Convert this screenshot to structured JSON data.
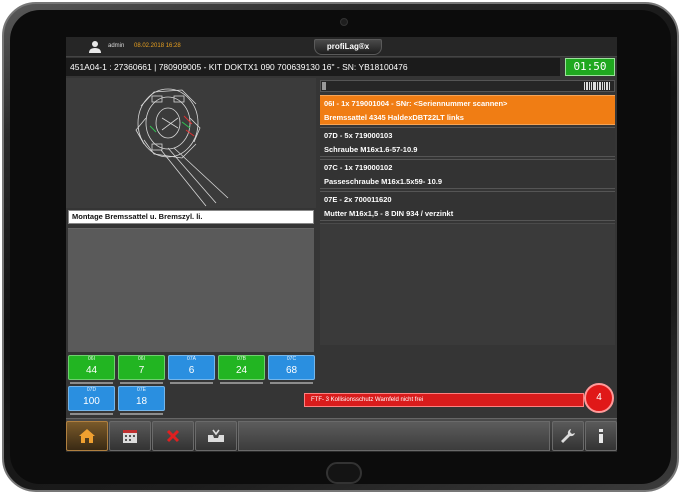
{
  "header": {
    "user": "admin",
    "timestamp": "08.02.2018 16:28",
    "brand": "profiLag®x"
  },
  "order": {
    "info": "451A04-1  : 27360661 | 780909005 - KIT DOKTX1 090 700639130 16\" - SN: YB18100476",
    "timer": "01:50"
  },
  "step": {
    "caption": "Montage Bremssattel u. Bremszyl. li."
  },
  "tiles": [
    {
      "label": "06I",
      "value": "44",
      "color": "#22b522"
    },
    {
      "label": "06I",
      "value": "7",
      "color": "#22b522"
    },
    {
      "label": "07A",
      "value": "6",
      "color": "#2a8fe0"
    },
    {
      "label": "07B",
      "value": "24",
      "color": "#22b522"
    },
    {
      "label": "07C",
      "value": "68",
      "color": "#2a8fe0"
    },
    {
      "label": "07D",
      "value": "100",
      "color": "#2a8fe0"
    },
    {
      "label": "07E",
      "value": "18",
      "color": "#2a8fe0"
    }
  ],
  "items": [
    {
      "line1": "06I - 1x 719001004 - SNr: <Seriennummer scannen>",
      "line2": "Bremssattel 4345 HaldexDBT22LT links",
      "active": true
    },
    {
      "line1": "07D - 5x 719000103",
      "line2": "Schraube M16x1.6-57-10.9",
      "active": false
    },
    {
      "line1": "07C - 1x 719000102",
      "line2": "Passeschraube M16x1.5x59- 10.9",
      "active": false
    },
    {
      "line1": "07E - 2x 700011620",
      "line2": "Mutter M16x1,5 - 8 DIN 934 / verzinkt",
      "active": false
    }
  ],
  "error": {
    "message": "FTF- 3 Kollisionsschutz Warnfeld nicht frei",
    "count": "4"
  },
  "toolbar": {
    "buttons": [
      "home-icon",
      "calendar-icon",
      "cancel-icon",
      "inbox-icon",
      "wrench-icon",
      "info-icon"
    ]
  },
  "colors": {
    "accent": "#f07d14",
    "ok": "#22b522",
    "info": "#2a8fe0",
    "alert": "#d91c1c",
    "timer": "#1fa81f"
  }
}
